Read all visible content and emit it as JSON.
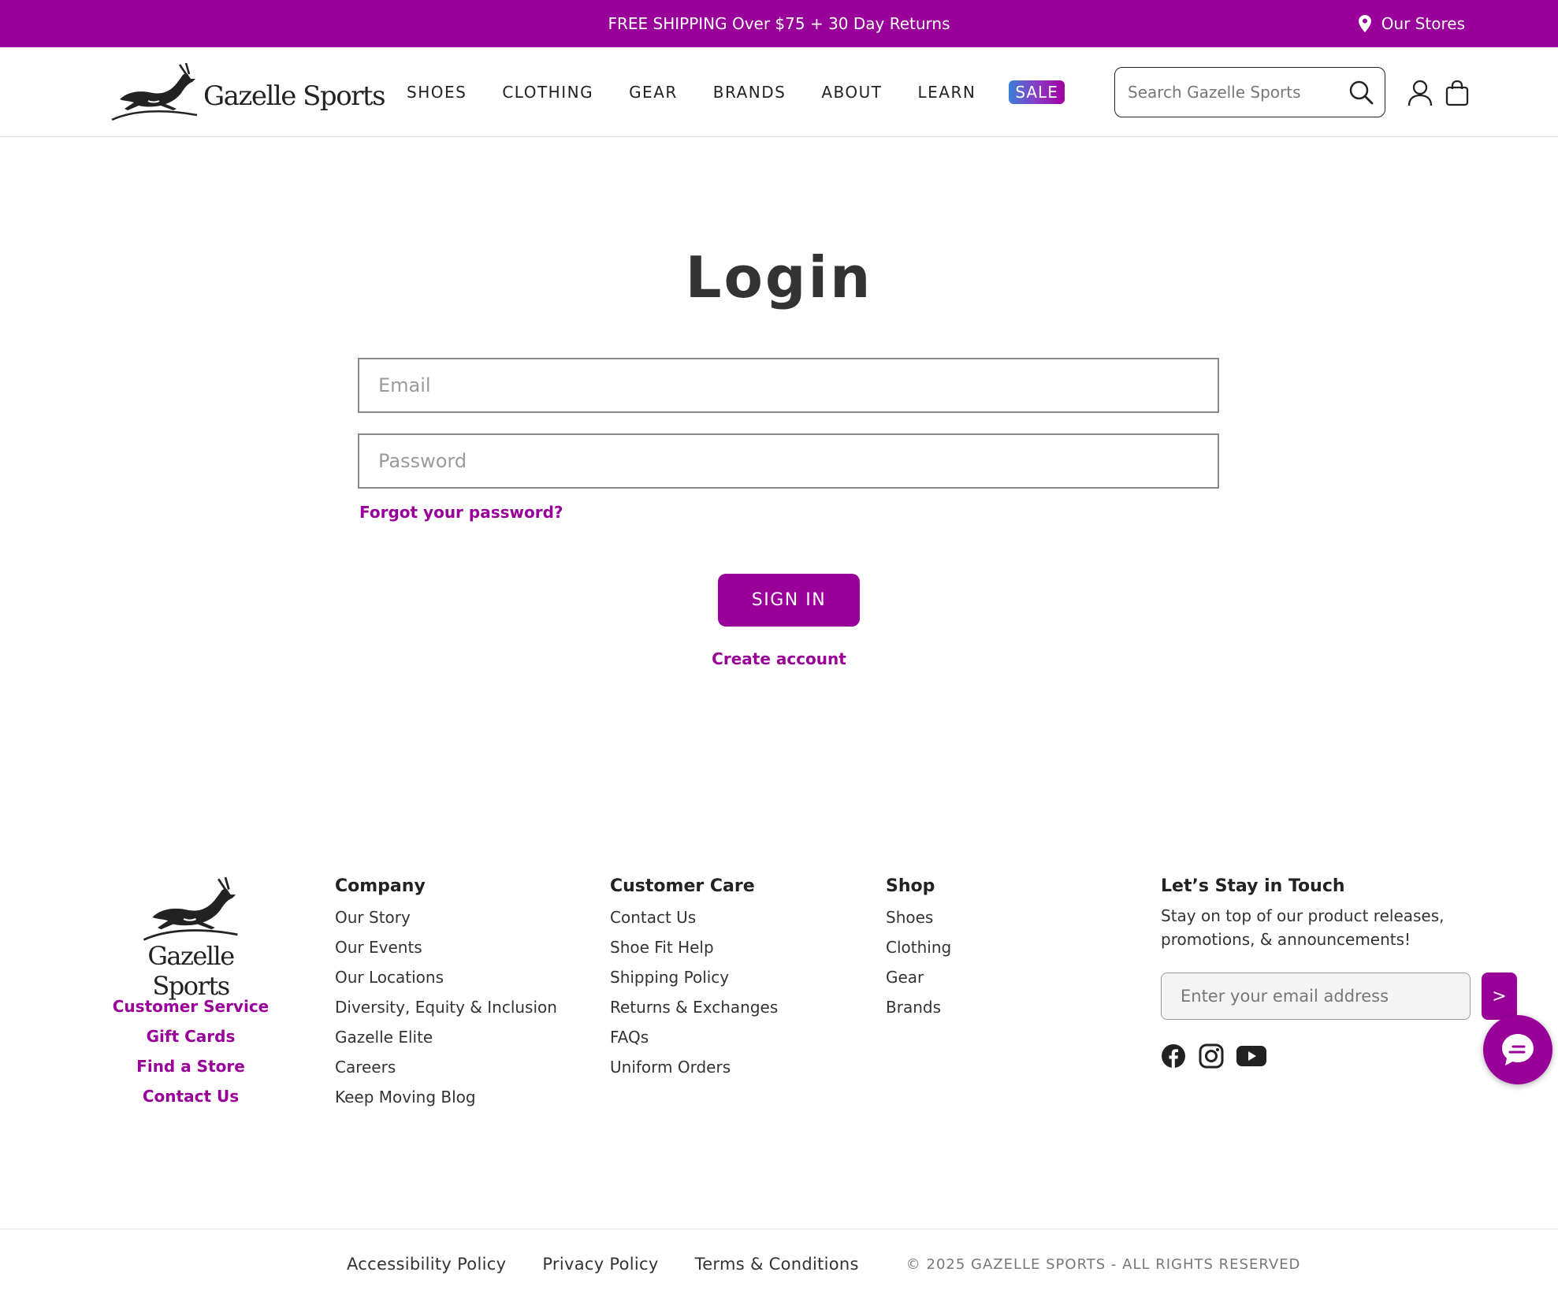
{
  "announcement": {
    "message": "FREE SHIPPING Over $75 + 30 Day Returns",
    "stores_label": "Our Stores"
  },
  "brand": {
    "name": "Gazelle Sports",
    "accent_color": "#990099"
  },
  "nav": {
    "items": [
      "SHOES",
      "CLOTHING",
      "GEAR",
      "BRANDS",
      "ABOUT",
      "LEARN"
    ],
    "sale_label": "SALE"
  },
  "search": {
    "placeholder": "Search Gazelle Sports"
  },
  "login": {
    "title": "Login",
    "email_placeholder": "Email",
    "password_placeholder": "Password",
    "forgot_label": "Forgot your password?",
    "signin_label": "SIGN IN",
    "create_label": "Create account"
  },
  "footer": {
    "quick_links": [
      "Customer Service",
      "Gift Cards",
      "Find a Store",
      "Contact Us"
    ],
    "company": {
      "heading": "Company",
      "links": [
        "Our Story",
        "Our Events",
        "Our Locations",
        "Diversity, Equity & Inclusion",
        "Gazelle Elite",
        "Careers",
        "Keep Moving Blog"
      ]
    },
    "customer_care": {
      "heading": "Customer Care",
      "links": [
        "Contact Us",
        "Shoe Fit Help",
        "Shipping Policy",
        "Returns & Exchanges",
        "FAQs",
        "Uniform Orders"
      ]
    },
    "shop": {
      "heading": "Shop",
      "links": [
        "Shoes",
        "Clothing",
        "Gear",
        "Brands"
      ]
    },
    "newsletter": {
      "heading": "Let’s Stay in Touch",
      "text": "Stay on top of our product releases, promotions, & announcements!",
      "placeholder": "Enter your email address",
      "submit_label": ">"
    },
    "social_icons": [
      "facebook-icon",
      "instagram-icon",
      "youtube-icon"
    ]
  },
  "bottom": {
    "links": [
      "Accessibility Policy",
      "Privacy Policy",
      "Terms & Conditions"
    ],
    "copyright": "© 2025 GAZELLE SPORTS - ALL RIGHTS RESERVED"
  }
}
